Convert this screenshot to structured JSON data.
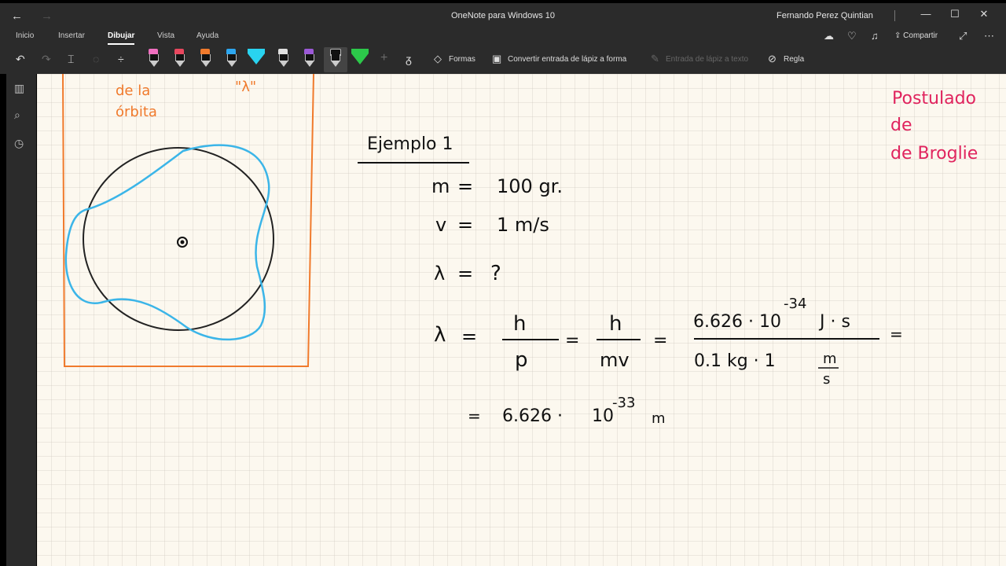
{
  "app": {
    "title": "OneNote para Windows 10",
    "user": "Fernando Perez Quintian",
    "window_controls": {
      "minimize": "—",
      "maximize": "☐",
      "close": "✕"
    },
    "nav": {
      "back_icon": "arrow-left-icon",
      "forward_icon": "arrow-right-icon"
    }
  },
  "tabs": [
    {
      "label": "Inicio"
    },
    {
      "label": "Insertar"
    },
    {
      "label": "Dibujar",
      "active": true
    },
    {
      "label": "Vista"
    },
    {
      "label": "Ayuda"
    }
  ],
  "tab_right": {
    "share_label": "Compartir"
  },
  "toolbar": {
    "shapes_label": "Formas",
    "convert_ink_shape_label": "Convertir entrada de lápiz a forma",
    "convert_ink_text_label": "Entrada de lápiz a texto",
    "ruler_label": "Regla",
    "pen_colors": [
      "#f06fc0",
      "#e8475e",
      "#f07a2c",
      "#2da7f0",
      "#29d3f0",
      "#e0e0e0",
      "#9b59d6",
      "#111111"
    ],
    "highlighter_colors": [
      "#2cc84a"
    ]
  },
  "note": {
    "accent_orange": "#f07a2c",
    "accent_blue": "#3bb5e8",
    "accent_red": "#e0245e",
    "top_fragment_left": [
      "de la",
      "órbita"
    ],
    "top_fragment_right": "\"λ\"",
    "side_note": [
      "Postulado",
      "de",
      "de Broglie"
    ],
    "example_title": "Ejemplo 1",
    "given": [
      {
        "var": "m",
        "eq": "=",
        "value": "100 gr."
      },
      {
        "var": "v",
        "eq": "=",
        "value": "1 m/s"
      },
      {
        "var": "λ",
        "eq": "=",
        "value": "?"
      }
    ],
    "formula": {
      "lhs": "λ",
      "eq": "=",
      "frac1": {
        "num": "h",
        "den": "p"
      },
      "frac2": {
        "num": "h",
        "den": "mv"
      },
      "frac3": {
        "num_base": "6.626 · 10",
        "num_exp": "-34",
        "num_unit": "J · s",
        "den": "0.1 kg ·  1",
        "den_unit_num": "m",
        "den_unit_den": "s"
      }
    },
    "result": {
      "coef": "6.626 ·",
      "base": "10",
      "exp": "-33",
      "unit": "m"
    }
  }
}
